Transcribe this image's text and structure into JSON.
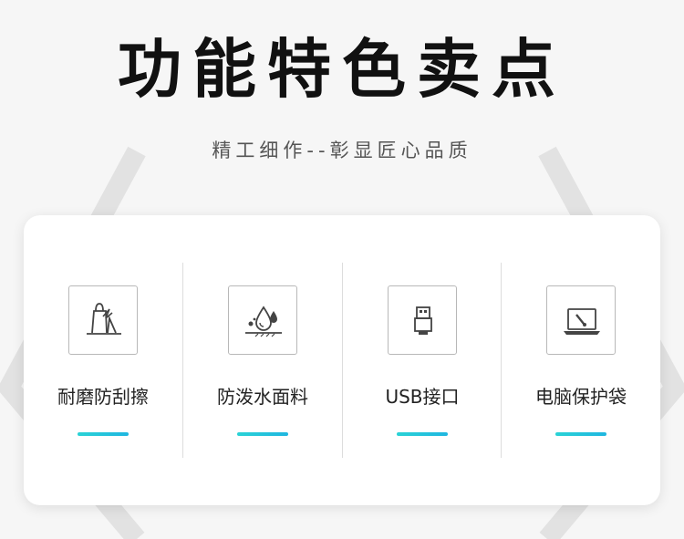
{
  "header": {
    "title": "功能特色卖点",
    "subtitle": "精工细作--彰显匠心品质"
  },
  "features": [
    {
      "label": "耐磨防刮擦",
      "icon": "scratch-resistant-icon"
    },
    {
      "label": "防泼水面料",
      "icon": "water-drop-icon"
    },
    {
      "label": "USB接口",
      "icon": "usb-icon"
    },
    {
      "label": "电脑保护袋",
      "icon": "laptop-icon"
    }
  ],
  "colors": {
    "accent": "#22c4dc",
    "background": "#f6f6f6",
    "card": "#ffffff"
  }
}
